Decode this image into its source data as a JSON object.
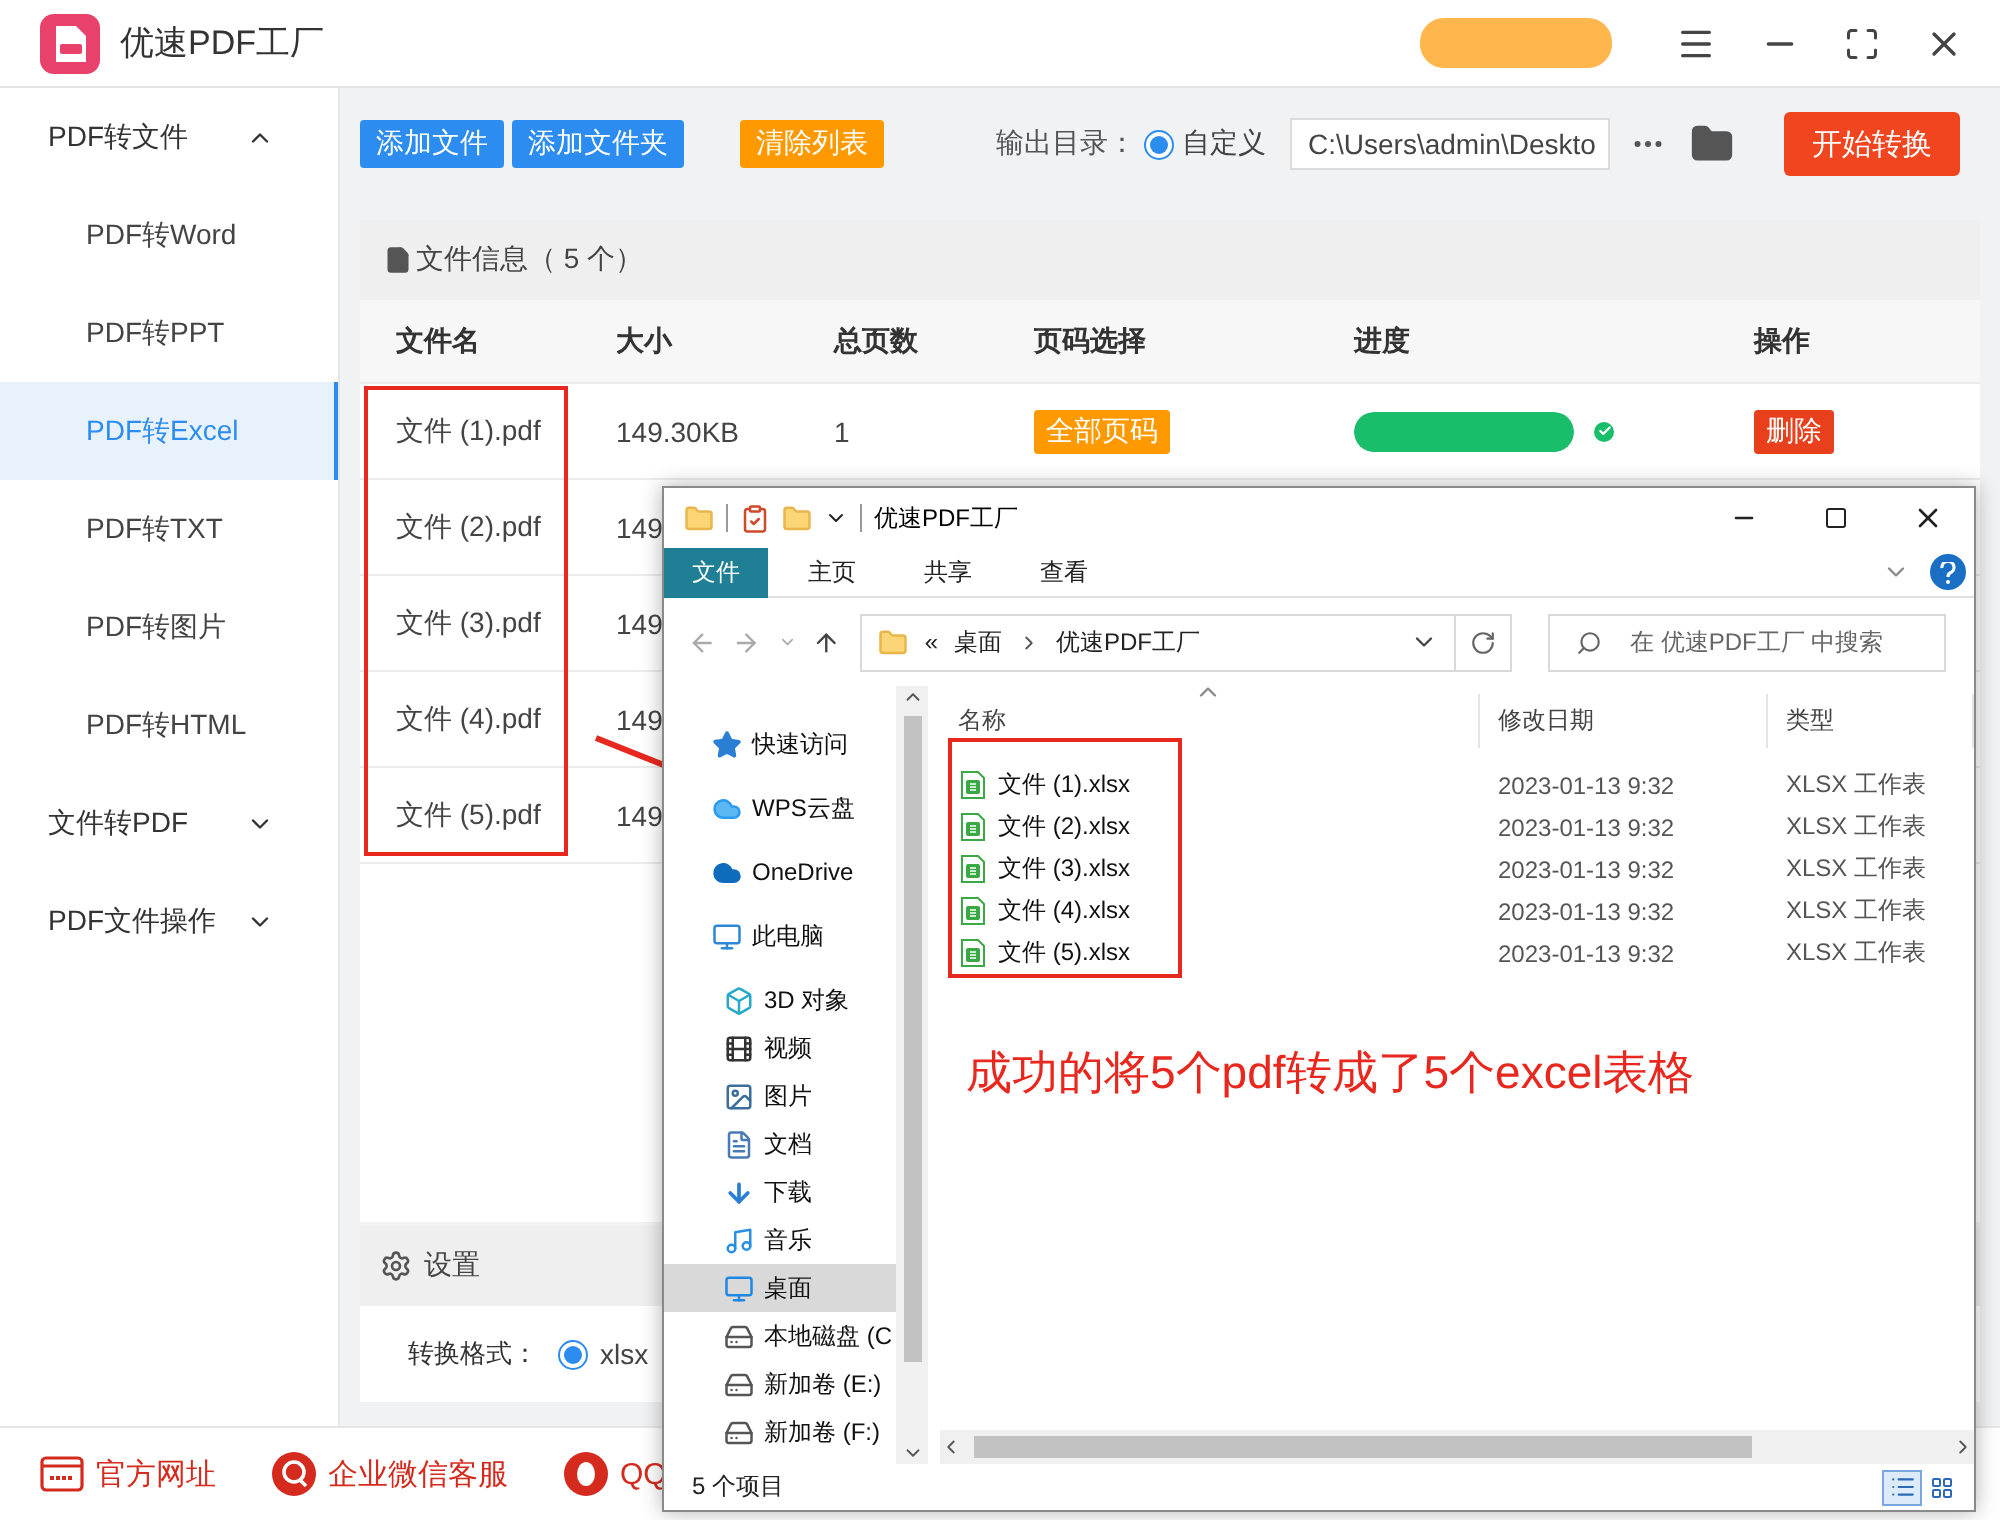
{
  "app": {
    "title": "优速PDF工厂"
  },
  "sidebar": {
    "items": [
      {
        "label": "PDF转文件",
        "expanded": true,
        "children": [
          {
            "label": "PDF转Word",
            "selected": false
          },
          {
            "label": "PDF转PPT",
            "selected": false
          },
          {
            "label": "PDF转Excel",
            "selected": true
          },
          {
            "label": "PDF转TXT",
            "selected": false
          },
          {
            "label": "PDF转图片",
            "selected": false
          },
          {
            "label": "PDF转HTML",
            "selected": false
          }
        ]
      },
      {
        "label": "文件转PDF",
        "expanded": false
      },
      {
        "label": "PDF文件操作",
        "expanded": false
      }
    ]
  },
  "toolbar": {
    "buttons": [
      {
        "label": "添加文件",
        "kind": "primary"
      },
      {
        "label": "添加文件夹",
        "kind": "primary"
      },
      {
        "label": "清除列表",
        "kind": "warning"
      }
    ],
    "output_label": "输出目录：",
    "output_option": {
      "label": "自定义",
      "selected": true
    },
    "path": "C:\\Users\\admin\\Deskto",
    "start_button": "开始转换"
  },
  "file_panel": {
    "title": "文件信息（ 5 个）",
    "columns": [
      "文件名",
      "大小",
      "总页数",
      "页码选择",
      "进度",
      "操作"
    ],
    "rows": [
      {
        "name": "文件 (1).pdf",
        "size": "149.30KB",
        "pages": "1",
        "page_range": "全部页码",
        "level": 1,
        "done": true,
        "action": "删除"
      },
      {
        "name": "文件 (2).pdf",
        "size": "149"
      },
      {
        "name": "文件 (3).pdf",
        "size": "149"
      },
      {
        "name": "文件 (4).pdf",
        "size": "149"
      },
      {
        "name": "文件 (5).pdf",
        "size": "149"
      }
    ]
  },
  "settings": {
    "title": "设置",
    "format_label": "转换格式：",
    "options": [
      {
        "label": "xlsx",
        "selected": true
      }
    ]
  },
  "footer": {
    "links": [
      {
        "label": "官方网址",
        "kind": "web"
      },
      {
        "label": "企业微信客服",
        "kind": "wechat"
      },
      {
        "label": "QQ",
        "kind": "qq"
      }
    ]
  },
  "explorer": {
    "title": "优速PDF工厂",
    "ribbon_tabs": [
      {
        "label": "文件",
        "selected": true
      },
      {
        "label": "主页",
        "selected": false
      },
      {
        "label": "共享",
        "selected": false
      },
      {
        "label": "查看",
        "selected": false
      }
    ],
    "address": {
      "prefix": "«",
      "segments": [
        "桌面",
        "优速PDF工厂"
      ]
    },
    "search": {
      "placeholder": "在 优速PDF工厂 中搜索"
    },
    "nav": [
      {
        "label": "快速访问",
        "kind": "star",
        "selected": false
      },
      {
        "label": "WPS云盘",
        "kind": "cloud",
        "selected": false
      },
      {
        "label": "OneDrive",
        "kind": "onedrive",
        "selected": false
      },
      {
        "label": "此电脑",
        "kind": "pc",
        "selected": false,
        "children": [
          {
            "label": "3D 对象",
            "kind": "cube",
            "selected": false
          },
          {
            "label": "视频",
            "kind": "video",
            "selected": false
          },
          {
            "label": "图片",
            "kind": "pictures",
            "selected": false
          },
          {
            "label": "文档",
            "kind": "docs",
            "selected": false
          },
          {
            "label": "下载",
            "kind": "download",
            "selected": false
          },
          {
            "label": "音乐",
            "kind": "music",
            "selected": false
          },
          {
            "label": "桌面",
            "kind": "desktop",
            "selected": true
          },
          {
            "label": "本地磁盘 (C",
            "kind": "disk",
            "selected": false
          },
          {
            "label": "新加卷 (E:)",
            "kind": "drive",
            "selected": false
          },
          {
            "label": "新加卷 (F:)",
            "kind": "drive",
            "selected": false
          }
        ]
      }
    ],
    "columns": [
      "名称",
      "修改日期",
      "类型"
    ],
    "files": [
      {
        "name": "文件 (1).xlsx",
        "date": "2023-01-13 9:32",
        "type": "XLSX 工作表"
      },
      {
        "name": "文件 (2).xlsx",
        "date": "2023-01-13 9:32",
        "type": "XLSX 工作表"
      },
      {
        "name": "文件 (3).xlsx",
        "date": "2023-01-13 9:32",
        "type": "XLSX 工作表"
      },
      {
        "name": "文件 (4).xlsx",
        "date": "2023-01-13 9:32",
        "type": "XLSX 工作表"
      },
      {
        "name": "文件 (5).xlsx",
        "date": "2023-01-13 9:32",
        "type": "XLSX 工作表"
      }
    ],
    "status": "5 个项目"
  },
  "annotation": {
    "text": "成功的将5个pdf转成了5个excel表格"
  }
}
